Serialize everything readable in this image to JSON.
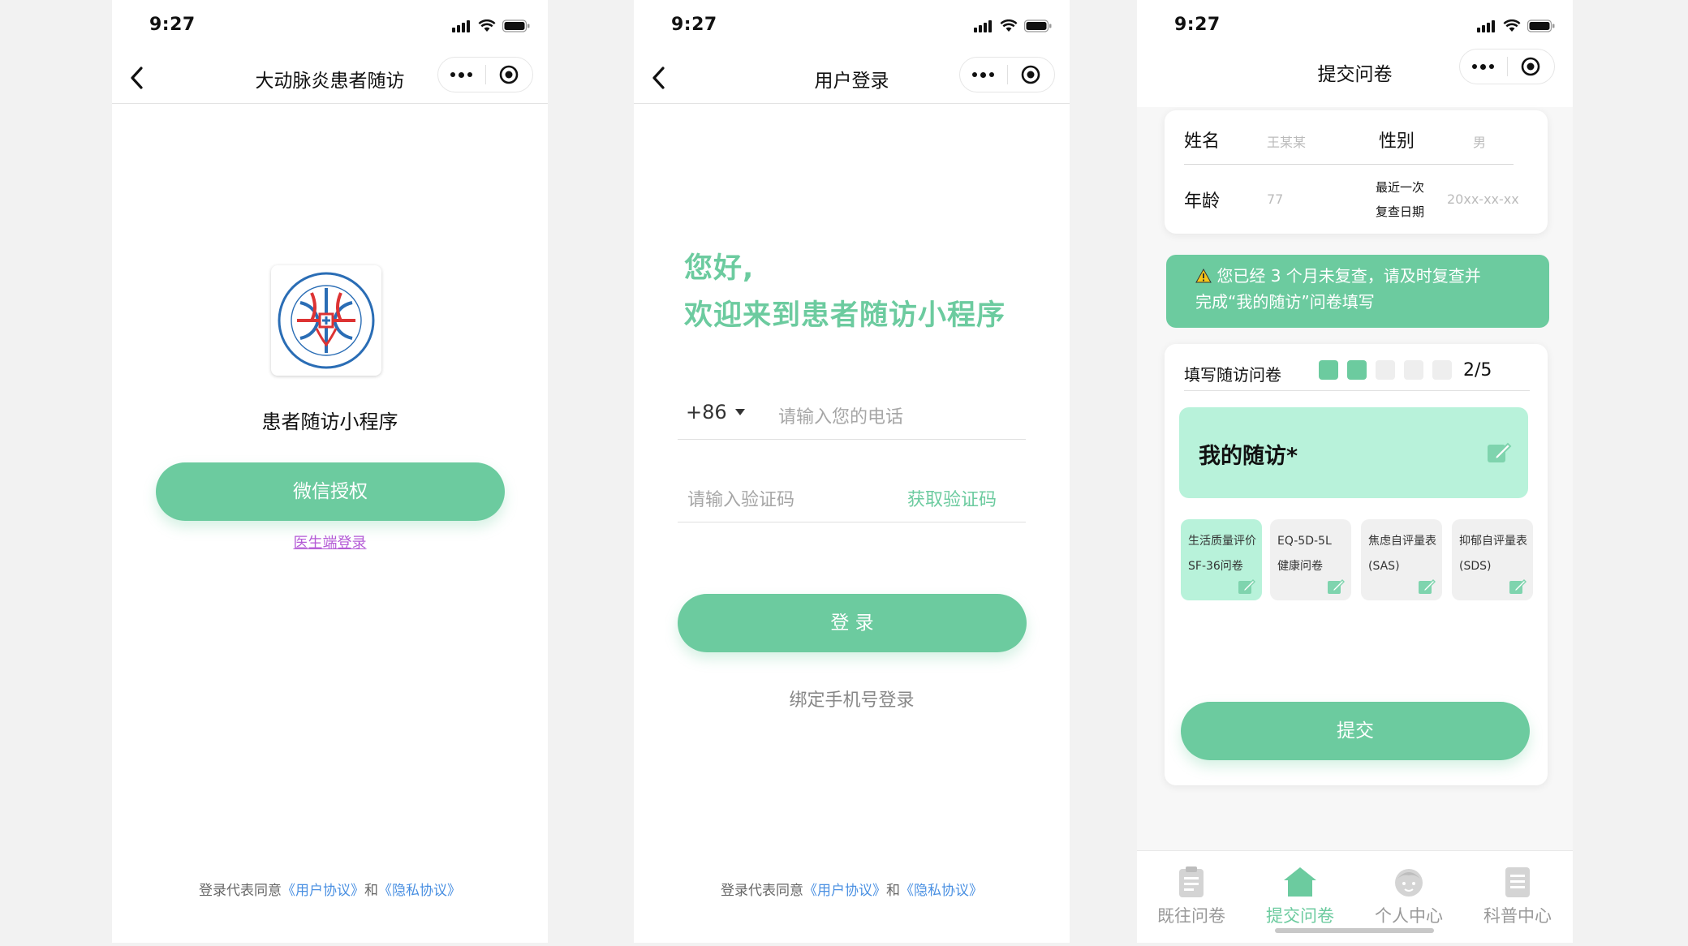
{
  "status_bar": {
    "time": "9:27"
  },
  "screen1": {
    "nav_title": "大动脉炎患者随访",
    "app_name": "患者随访小程序",
    "wechat_auth_button": "微信授权",
    "doctor_login_link": "医生端登录",
    "agreement": {
      "prefix": "登录代表同意",
      "user_agreement": "《用户协议》",
      "and": "和",
      "privacy_agreement": "《隐私协议》"
    }
  },
  "screen2": {
    "nav_title": "用户登录",
    "greeting_line1": "您好,",
    "greeting_line2": "欢迎来到患者随访小程序",
    "country_code": "+86",
    "phone_placeholder": "请输入您的电话",
    "code_placeholder": "请输入验证码",
    "get_code_button": "获取验证码",
    "login_button": "登 录",
    "bind_phone_link": "绑定手机号登录",
    "agreement": {
      "prefix": "登录代表同意",
      "user_agreement": "《用户协议》",
      "and": "和",
      "privacy_agreement": "《隐私协议》"
    }
  },
  "screen3": {
    "nav_title": "提交问卷",
    "info": {
      "name_label": "姓名",
      "name_value": "王某某",
      "gender_label": "性别",
      "gender_value": "男",
      "age_label": "年龄",
      "age_value": "77",
      "last_check_label_line1": "最近一次",
      "last_check_label_line2": "复查日期",
      "last_check_value": "20xx-xx-xx"
    },
    "warning": {
      "icon": "warning-icon",
      "line1": "您已经 3 个月未复查，请及时复查并",
      "line2": "完成“我的随访”问卷填写"
    },
    "progress": {
      "label": "填写随访问卷",
      "completed": 2,
      "total": 5,
      "text": "2/5"
    },
    "my_followup": {
      "title": "我的随访*"
    },
    "questionnaires": [
      {
        "line1": "生活质量评价",
        "line2": "SF-36问卷",
        "active": true
      },
      {
        "line1": "EQ-5D-5L",
        "line2": "健康问卷",
        "active": false
      },
      {
        "line1": "焦虑自评量表",
        "line2": "(SAS)",
        "active": false
      },
      {
        "line1": "抑郁自评量表",
        "line2": "(SDS)",
        "active": false
      }
    ],
    "submit_button": "提交",
    "tabs": [
      {
        "label": "既往问卷",
        "icon": "clipboard-icon",
        "active": false
      },
      {
        "label": "提交问卷",
        "icon": "home-icon",
        "active": true
      },
      {
        "label": "个人中心",
        "icon": "baby-face-icon",
        "active": false
      },
      {
        "label": "科普中心",
        "icon": "document-icon",
        "active": false
      }
    ]
  },
  "colors": {
    "accent": "#6ccb9f",
    "accent_light": "#b8f2da",
    "link_blue": "#4a90e2",
    "doctor_link": "#b45ad6"
  }
}
